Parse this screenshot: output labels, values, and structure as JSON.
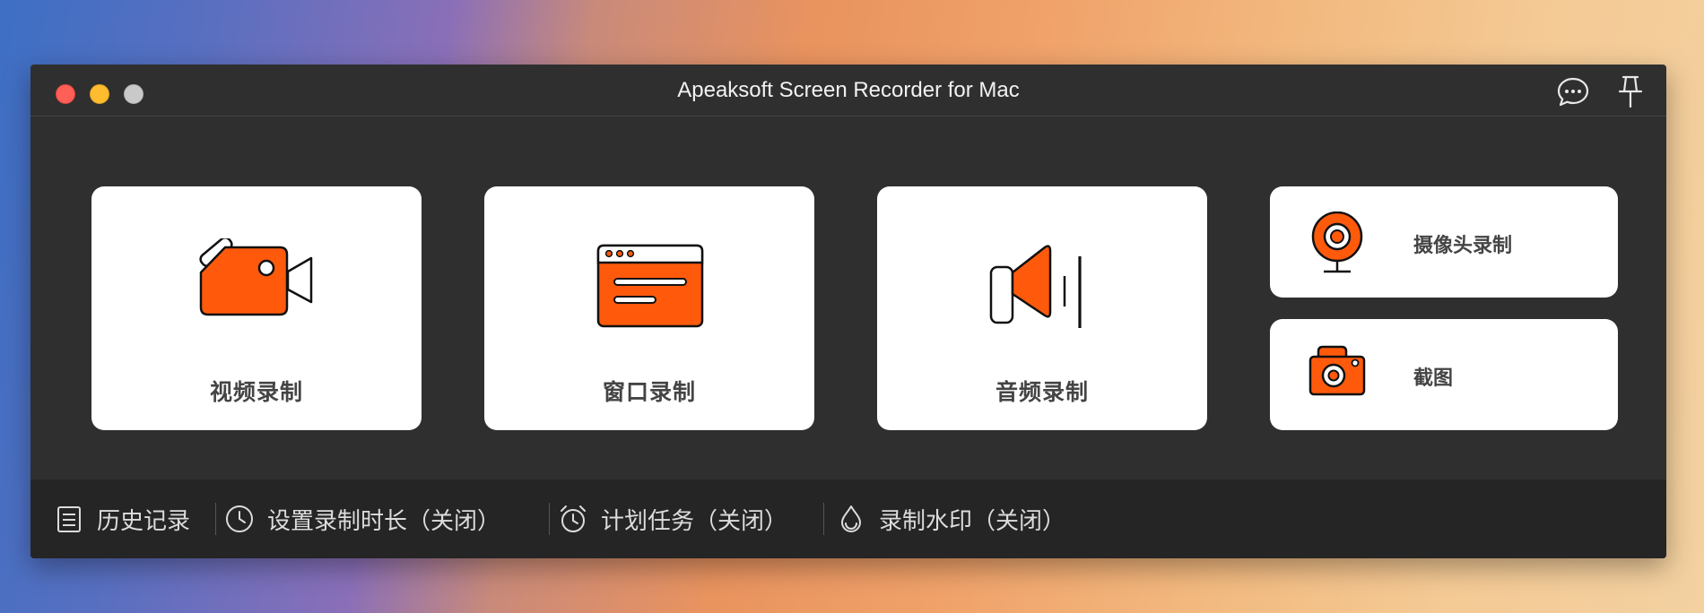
{
  "window": {
    "title": "Apeaksoft Screen Recorder for Mac"
  },
  "titlebar_icons": [
    "chat-bubble-icon",
    "pin-icon"
  ],
  "colors": {
    "accent": "#ff5a0c",
    "window_bg": "#2f2f2f",
    "card_bg": "#ffffff",
    "bottombar_bg": "#252525"
  },
  "modes": {
    "video": {
      "label": "视频录制",
      "icon": "video-camera-icon"
    },
    "window": {
      "label": "窗口录制",
      "icon": "browser-window-icon"
    },
    "audio": {
      "label": "音频录制",
      "icon": "speaker-icon"
    },
    "webcam": {
      "label": "摄像头录制",
      "icon": "webcam-icon"
    },
    "snapshot": {
      "label": "截图",
      "icon": "camera-icon"
    }
  },
  "bottombar": {
    "history": {
      "label": "历史记录",
      "icon": "list-icon"
    },
    "duration": {
      "label": "设置录制时长（关闭）",
      "icon": "clock-icon"
    },
    "schedule": {
      "label": "计划任务（关闭）",
      "icon": "alarm-clock-icon"
    },
    "watermark": {
      "label": "录制水印（关闭）",
      "icon": "water-drop-icon"
    }
  }
}
